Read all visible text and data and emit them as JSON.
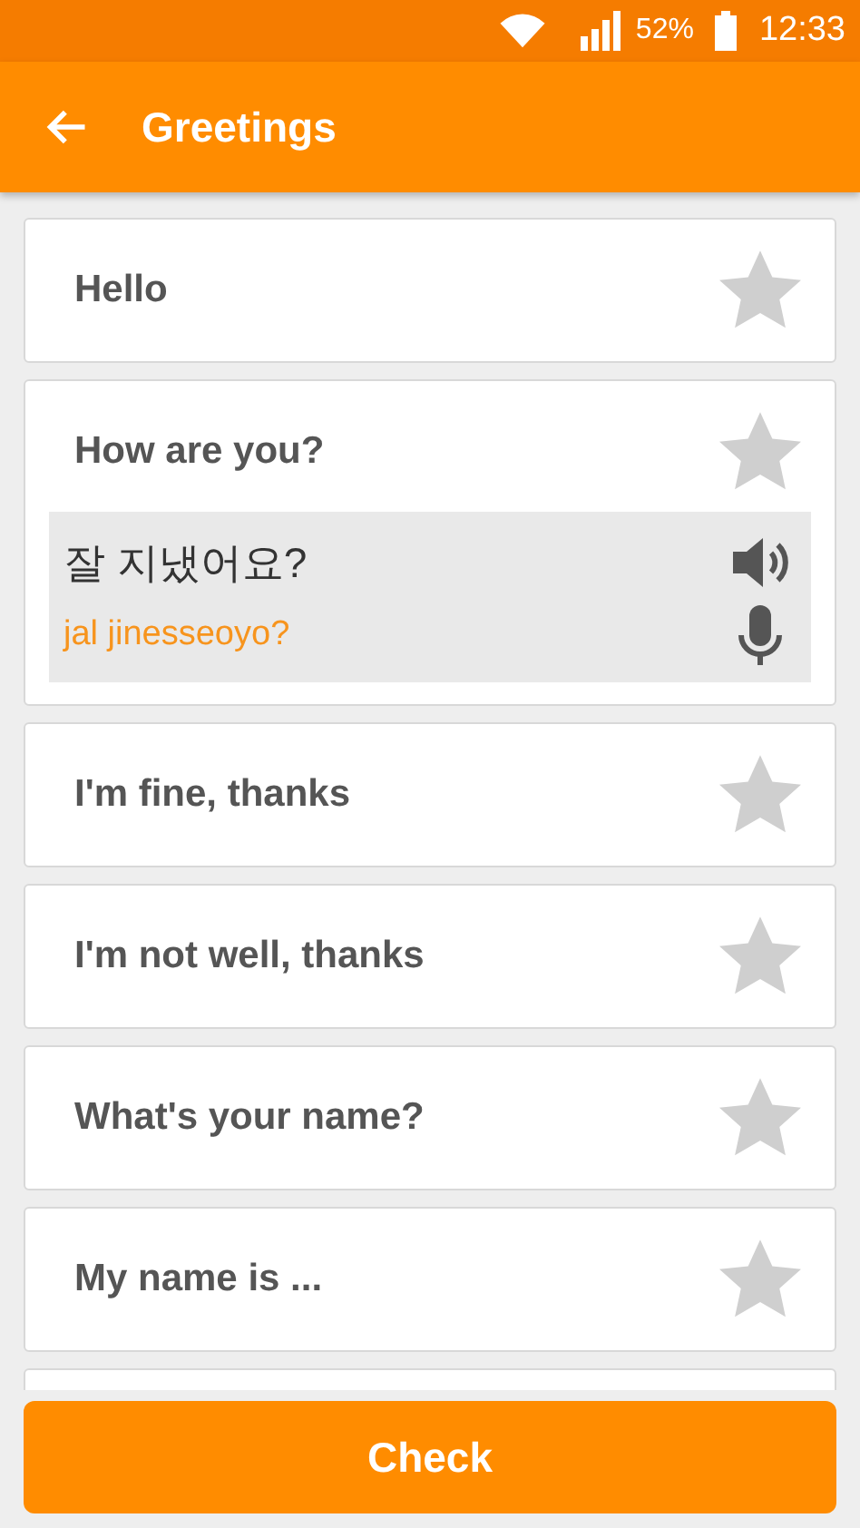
{
  "status_bar": {
    "battery_text": "52%",
    "time": "12:33"
  },
  "app_bar": {
    "title": "Greetings"
  },
  "phrases": [
    {
      "label": "Hello",
      "starred": false,
      "expanded": false
    },
    {
      "label": "How are you?",
      "starred": false,
      "expanded": true,
      "translation": "잘 지냈어요?",
      "romanization": "jal jinesseoyo?"
    },
    {
      "label": "I'm fine, thanks",
      "starred": false,
      "expanded": false
    },
    {
      "label": "I'm not well, thanks",
      "starred": false,
      "expanded": false
    },
    {
      "label": "What's your name?",
      "starred": false,
      "expanded": false
    },
    {
      "label": "My name is ...",
      "starred": false,
      "expanded": false
    }
  ],
  "button": {
    "label": "Check"
  }
}
